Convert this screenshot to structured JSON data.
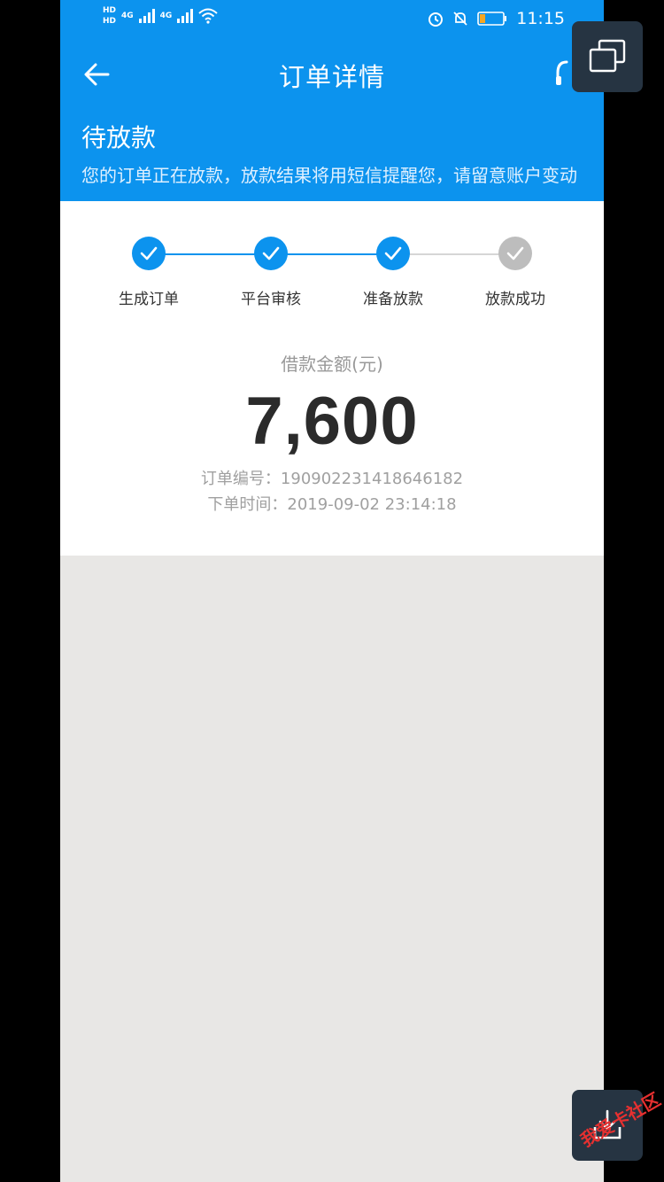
{
  "status_bar": {
    "network_left": "HD",
    "network_sub": "4G",
    "time": "11:15"
  },
  "nav": {
    "title": "订单详情",
    "back_icon": "arrow-left-icon",
    "support_icon": "headset-icon"
  },
  "order_status": {
    "title": "待放款",
    "description": "您的订单正在放款，放款结果将用短信提醒您，请留意账户变动"
  },
  "steps": [
    {
      "label": "生成订单",
      "done": true
    },
    {
      "label": "平台审核",
      "done": true
    },
    {
      "label": "准备放款",
      "done": true
    },
    {
      "label": "放款成功",
      "done": false
    }
  ],
  "loan": {
    "amount_label": "借款金额(元)",
    "amount": "7,600",
    "order_number": "订单编号：190902231418646182",
    "order_time": "下单时间：2019-09-02 23:14:18"
  },
  "colors": {
    "primary": "#0c93ee",
    "step_done": "#0c93ee",
    "step_pending": "#bdbdbd"
  },
  "watermark": "我爱卡社区"
}
